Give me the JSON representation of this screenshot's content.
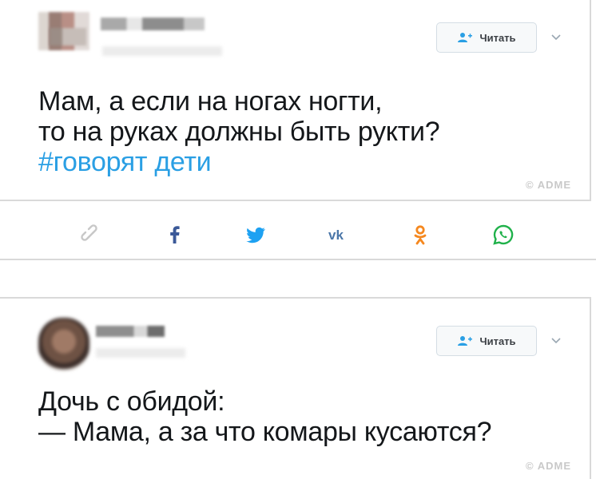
{
  "tweet1": {
    "follow_label": "Читать",
    "text": "Мам, а если на ногах ногти,\nто на руках должны быть рукти?",
    "hashtag": "#говорят дети",
    "watermark": "© ADME"
  },
  "share_bar": {
    "icons": [
      "link-icon",
      "facebook-icon",
      "twitter-icon",
      "vk-icon",
      "odnoklassniki-icon",
      "whatsapp-icon"
    ],
    "colors": {
      "link": "#c8c8c8",
      "facebook": "#3b5998",
      "twitter": "#1da1f2",
      "vk": "#4a76a8",
      "odnoklassniki": "#f5881f",
      "whatsapp": "#1fb14a"
    }
  },
  "tweet2": {
    "follow_label": "Читать",
    "text": "Дочь с обидой:\n— Мама, а за что комары кусаются?",
    "watermark": "© ADME"
  },
  "colors": {
    "hashtag": "#2a9fe4",
    "text": "#14171a",
    "follow_icon": "#2a9fe4"
  }
}
